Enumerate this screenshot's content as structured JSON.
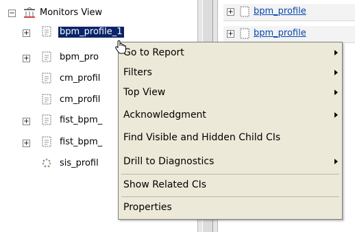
{
  "tree": {
    "root_label": "Monitors View",
    "items": [
      {
        "label": "bpm_profile_1",
        "expandable": true
      },
      {
        "label": "bpm_pro",
        "expandable": true
      },
      {
        "label": "cm_profil",
        "expandable": false
      },
      {
        "label": "cm_profil",
        "expandable": false
      },
      {
        "label": "fist_bpm_",
        "expandable": true
      },
      {
        "label": "fist_bpm_",
        "expandable": true
      },
      {
        "label": "sis_profil",
        "expandable": false
      }
    ]
  },
  "right_pane": {
    "rows": [
      {
        "label": "bpm_profile"
      },
      {
        "label": "bpm_profile"
      }
    ]
  },
  "context_menu": {
    "items": [
      {
        "label": "Go to Report",
        "submenu": true
      },
      {
        "label": "Filters",
        "submenu": true
      },
      {
        "label": "Top View",
        "submenu": true
      },
      {
        "label": "Acknowledgment",
        "submenu": true
      },
      {
        "label": "Find Visible and Hidden Child CIs",
        "submenu": false
      },
      {
        "label": "Drill to Diagnostics",
        "submenu": true
      },
      {
        "label": "Show Related CIs",
        "submenu": false
      },
      {
        "label": "Properties",
        "submenu": false
      }
    ]
  },
  "colors": {
    "selection": "#0a246a",
    "menu_background": "#ece9d8",
    "link": "#0645ad"
  }
}
